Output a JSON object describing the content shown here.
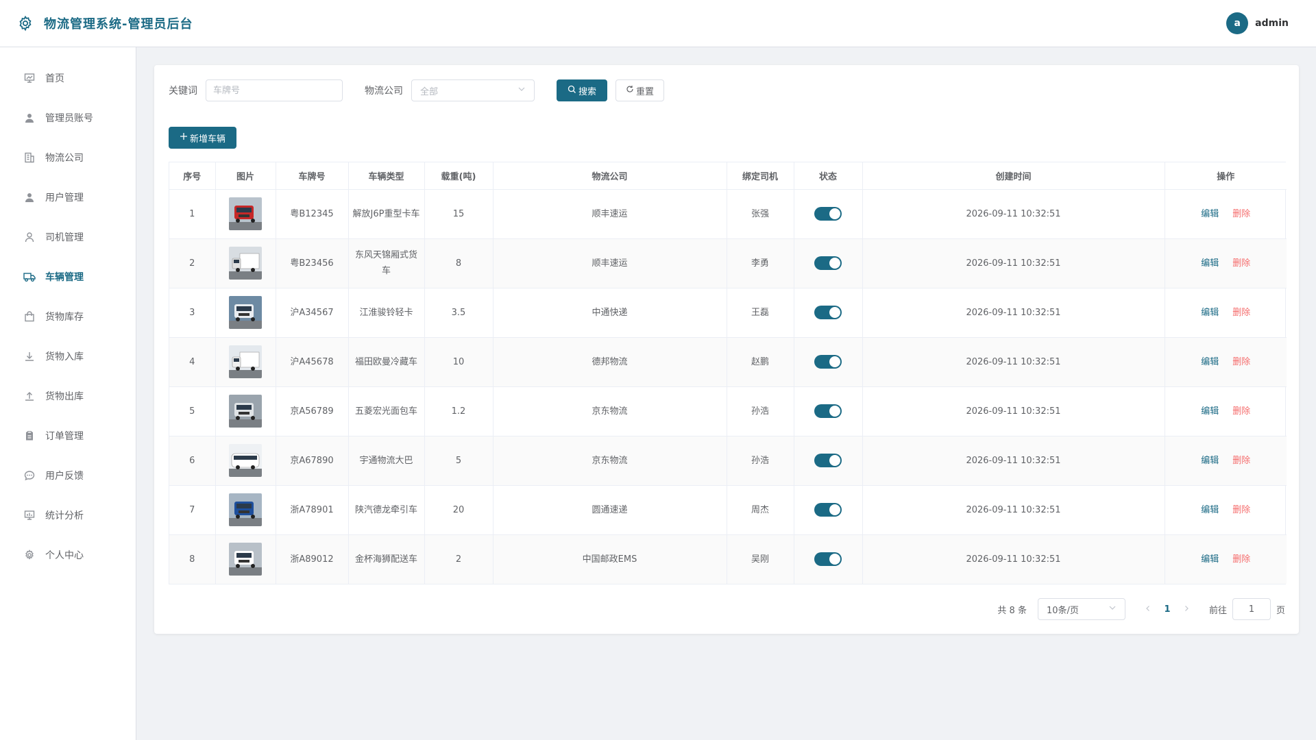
{
  "header": {
    "title": "物流管理系统-管理员后台",
    "avatar_letter": "a",
    "username": "admin"
  },
  "sidebar": {
    "items": [
      {
        "label": "首页",
        "icon": "dashboard-icon"
      },
      {
        "label": "管理员账号",
        "icon": "user-solid-icon"
      },
      {
        "label": "物流公司",
        "icon": "office-building-icon"
      },
      {
        "label": "用户管理",
        "icon": "user-solid-icon"
      },
      {
        "label": "司机管理",
        "icon": "user-outline-icon"
      },
      {
        "label": "车辆管理",
        "icon": "truck-icon",
        "active": true
      },
      {
        "label": "货物库存",
        "icon": "shopping-bag-icon"
      },
      {
        "label": "货物入库",
        "icon": "download-icon"
      },
      {
        "label": "货物出库",
        "icon": "upload-icon"
      },
      {
        "label": "订单管理",
        "icon": "document-icon"
      },
      {
        "label": "用户反馈",
        "icon": "chat-icon"
      },
      {
        "label": "统计分析",
        "icon": "data-analysis-icon"
      },
      {
        "label": "个人中心",
        "icon": "setting-icon"
      }
    ]
  },
  "filters": {
    "keyword_label": "关键词",
    "keyword_placeholder": "车牌号",
    "company_label": "物流公司",
    "company_value": "全部",
    "search_label": "搜索",
    "reset_label": "重置"
  },
  "add_button_label": "新增车辆",
  "table": {
    "headers": [
      "序号",
      "图片",
      "车牌号",
      "车辆类型",
      "载重(吨)",
      "物流公司",
      "绑定司机",
      "状态",
      "创建时间",
      "操作"
    ],
    "rows": [
      {
        "index": "1",
        "plate": "粤B12345",
        "type": "解放J6P重型卡车",
        "load": "15",
        "company": "顺丰速运",
        "driver": "张强",
        "enabled": true,
        "created": "2026-09-11 10:32:51",
        "edit": "编辑",
        "delete": "删除"
      },
      {
        "index": "2",
        "plate": "粤B23456",
        "type": "东风天锦厢式货车",
        "load": "8",
        "company": "顺丰速运",
        "driver": "李勇",
        "enabled": true,
        "created": "2026-09-11 10:32:51",
        "edit": "编辑",
        "delete": "删除"
      },
      {
        "index": "3",
        "plate": "沪A34567",
        "type": "江淮骏铃轻卡",
        "load": "3.5",
        "company": "中通快递",
        "driver": "王磊",
        "enabled": true,
        "created": "2026-09-11 10:32:51",
        "edit": "编辑",
        "delete": "删除"
      },
      {
        "index": "4",
        "plate": "沪A45678",
        "type": "福田欧曼冷藏车",
        "load": "10",
        "company": "德邦物流",
        "driver": "赵鹏",
        "enabled": true,
        "created": "2026-09-11 10:32:51",
        "edit": "编辑",
        "delete": "删除"
      },
      {
        "index": "5",
        "plate": "京A56789",
        "type": "五菱宏光面包车",
        "load": "1.2",
        "company": "京东物流",
        "driver": "孙浩",
        "enabled": true,
        "created": "2026-09-11 10:32:51",
        "edit": "编辑",
        "delete": "删除"
      },
      {
        "index": "6",
        "plate": "京A67890",
        "type": "宇通物流大巴",
        "load": "5",
        "company": "京东物流",
        "driver": "孙浩",
        "enabled": true,
        "created": "2026-09-11 10:32:51",
        "edit": "编辑",
        "delete": "删除"
      },
      {
        "index": "7",
        "plate": "浙A78901",
        "type": "陕汽德龙牵引车",
        "load": "20",
        "company": "圆通速递",
        "driver": "周杰",
        "enabled": true,
        "created": "2026-09-11 10:32:51",
        "edit": "编辑",
        "delete": "删除"
      },
      {
        "index": "8",
        "plate": "浙A89012",
        "type": "金杯海狮配送车",
        "load": "2",
        "company": "中国邮政EMS",
        "driver": "吴刚",
        "enabled": true,
        "created": "2026-09-11 10:32:51",
        "edit": "编辑",
        "delete": "删除"
      }
    ]
  },
  "pagination": {
    "total_text": "共 8 条",
    "page_size": "10条/页",
    "current_page": "1",
    "goto_label": "前往",
    "goto_value": "1",
    "goto_suffix": "页"
  },
  "colors": {
    "primary": "#1b6a85",
    "danger": "#f56c6c",
    "background": "#f0f2f5"
  }
}
